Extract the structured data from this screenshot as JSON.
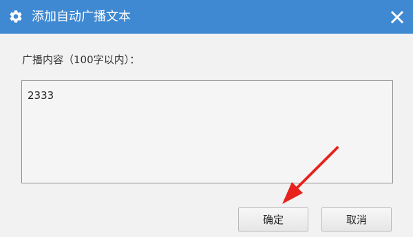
{
  "dialog": {
    "title": "添加自动广播文本",
    "title_icon": "gear-icon",
    "close_icon": "close-icon",
    "titlebar_color": "#3f89d2"
  },
  "form": {
    "label": "广播内容（100字以内）：",
    "content_value": "2333"
  },
  "buttons": {
    "ok_label": "确定",
    "cancel_label": "取消"
  },
  "annotation": {
    "arrow_color": "#e8231d"
  }
}
